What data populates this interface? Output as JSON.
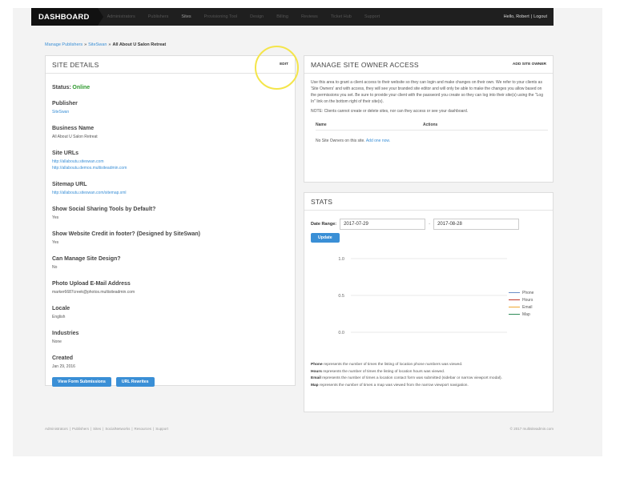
{
  "nav": {
    "brand": "DASHBOARD",
    "links": [
      "Administrators",
      "Publishers",
      "Sites",
      "Provisioning Tool",
      "Design",
      "Billing",
      "Reviews",
      "Ticket Hub",
      "Support"
    ],
    "active_index": 2,
    "user": "Hello, Robert",
    "separator": "|",
    "logout": "Logout"
  },
  "breadcrumb": {
    "item1": "Manage Publishers",
    "sep": "»",
    "item2": "SiteSwan",
    "current": "All About U Salon Retreat"
  },
  "site_details": {
    "title": "SITE DETAILS",
    "edit": "EDIT",
    "status_label": "Status:",
    "status_value": "Online",
    "publisher_label": "Publisher",
    "publisher_value": "SiteSwan",
    "business_name_label": "Business Name",
    "business_name_value": "All About U Salon Retreat",
    "site_urls_label": "Site URLs",
    "site_url_1": "http://allaboutu.siteswan.com",
    "site_url_2": "http://allaboutu.demos.multisiteadmin.com",
    "sitemap_label": "Sitemap URL",
    "sitemap_value": "http://allaboutu.siteswan.com/sitemap.xml",
    "social_label": "Show Social Sharing Tools by Default?",
    "social_value": "Yes",
    "credit_label": "Show Website Credit in footer? (Designed by SiteSwan)",
    "credit_value": "Yes",
    "design_label": "Can Manage Site Design?",
    "design_value": "No",
    "photo_label": "Photo Upload E-Mail Address",
    "photo_value": "marker6687creek@photos.multisiteadmin.com",
    "locale_label": "Locale",
    "locale_value": "English",
    "industries_label": "Industries",
    "industries_value": "None",
    "created_label": "Created",
    "created_value": "Jan 29, 2016",
    "btn_forms": "View Form Submissions",
    "btn_rewrites": "URL Rewrites"
  },
  "owner_access": {
    "title": "MANAGE SITE OWNER ACCESS",
    "add": "ADD SITE OWNER",
    "description": "Use this area to grant a client access to their website so they can login and make changes on their own. We refer to your clients as 'Site Owners' and with access, they will see your branded site editor and will only be able to make the changes you allow based on the permissions you set. Be sure to provide your client with the password you create so they can log into their site(s) using the \"Log In\" link on the bottom right of their site(s).",
    "note": "NOTE: Clients cannot create or delete sites, nor can they access or see your dashboard.",
    "col_name": "Name",
    "col_actions": "Actions",
    "empty_text": "No Site Owners on this site.",
    "empty_link": "Add one now."
  },
  "stats": {
    "title": "STATS",
    "date_range_label": "Date Range:",
    "date_from": "2017-07-29",
    "date_sep": "-",
    "date_to": "2017-08-28",
    "update": "Update",
    "notes": {
      "phone_term": "Phone",
      "phone_text": " represents the number of times the listing of location phone numbers was viewed.",
      "hours_term": "Hours",
      "hours_text": " represents the number of times the listing of location hours was viewed.",
      "email_term": "Email",
      "email_text": " represents the number of times a location contact form was submitted (sidebar or narrow viewport modal).",
      "map_term": "Map",
      "map_text": " represents the number of times a map was viewed from the narrow viewport navigation."
    }
  },
  "chart_data": {
    "type": "line",
    "title": "",
    "xlabel": "",
    "ylabel": "",
    "ylim": [
      0,
      1
    ],
    "yticks": [
      "1.0",
      "0.5",
      "0.0"
    ],
    "grid": true,
    "legend_position": "right",
    "series": [
      {
        "name": "Phone",
        "color": "#6b8fc7",
        "values": []
      },
      {
        "name": "Hours",
        "color": "#c0392b",
        "values": []
      },
      {
        "name": "Email",
        "color": "#f0a830",
        "values": []
      },
      {
        "name": "Map",
        "color": "#2e8b57",
        "values": []
      }
    ]
  },
  "footer": {
    "links": [
      "Administrators",
      "Publishers",
      "Sites",
      "SocialNetworks",
      "Resources",
      "Support"
    ],
    "copyright": "© 2017 multisiteadmin.com"
  }
}
